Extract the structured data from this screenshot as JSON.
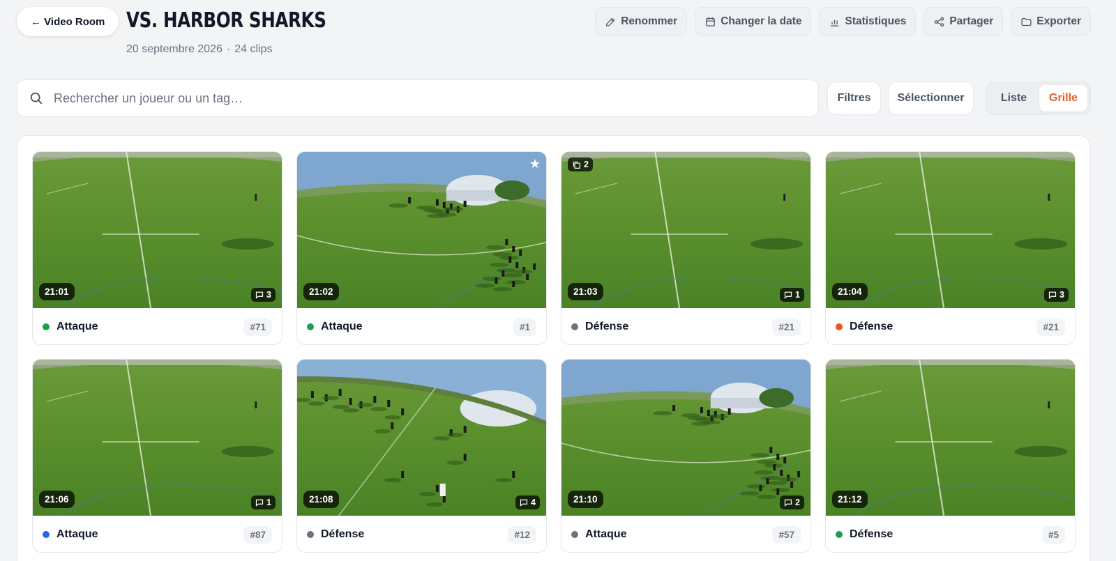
{
  "header": {
    "back_label": "← Video Room",
    "title": "VS. HARBOR SHARKS",
    "date": "20 septembre 2026",
    "separator": "·",
    "clip_count": "24 clips"
  },
  "actions": [
    {
      "label": "Renommer",
      "icon": "pencil-icon"
    },
    {
      "label": "Changer la date",
      "icon": "calendar-icon"
    },
    {
      "label": "Statistiques",
      "icon": "bar-chart-icon"
    },
    {
      "label": "Partager",
      "icon": "share-icon"
    },
    {
      "label": "Exporter",
      "icon": "folder-icon"
    }
  ],
  "search": {
    "placeholder": "Rechercher un joueur ou un tag…",
    "value": ""
  },
  "toolbar": {
    "filters_label": "Filtres",
    "select_label": "Sélectionner"
  },
  "view_toggle": {
    "list_label": "Liste",
    "grid_label": "Grille",
    "active": "grid"
  },
  "colors": {
    "accent": "#e85d2a",
    "green": "#16a34a",
    "gray": "#6b7280",
    "orange": "#f0531d",
    "blue": "#2563eb"
  },
  "clips": [
    {
      "time": "21:01",
      "comments": "3",
      "tag": "Attaque",
      "num": "#71",
      "dot": "#16a34a",
      "scene": "empty"
    },
    {
      "time": "21:02",
      "comments": "",
      "tag": "Attaque",
      "num": "#1",
      "dot": "#16a34a",
      "scene": "players",
      "starred": true
    },
    {
      "time": "21:03",
      "comments": "1",
      "tag": "Défense",
      "num": "#21",
      "dot": "#6b7280",
      "scene": "empty",
      "clips": "2"
    },
    {
      "time": "21:04",
      "comments": "3",
      "tag": "Défense",
      "num": "#21",
      "dot": "#f0531d",
      "scene": "empty"
    },
    {
      "time": "21:06",
      "comments": "1",
      "tag": "Attaque",
      "num": "#87",
      "dot": "#2563eb",
      "scene": "empty"
    },
    {
      "time": "21:08",
      "comments": "4",
      "tag": "Défense",
      "num": "#12",
      "dot": "#6b7280",
      "scene": "spread"
    },
    {
      "time": "21:10",
      "comments": "2",
      "tag": "Attaque",
      "num": "#57",
      "dot": "#6b7280",
      "scene": "players"
    },
    {
      "time": "21:12",
      "comments": "",
      "tag": "Défense",
      "num": "#5",
      "dot": "#16a34a",
      "scene": "empty"
    }
  ]
}
